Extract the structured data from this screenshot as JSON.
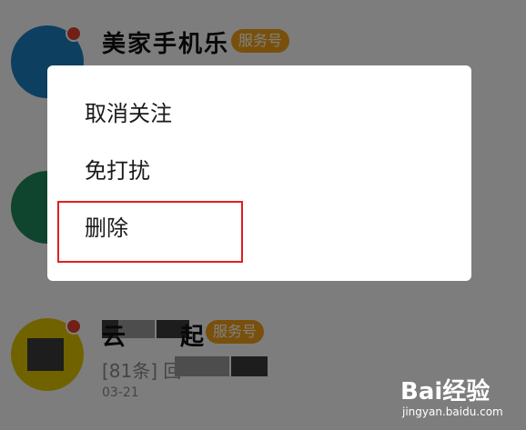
{
  "chat_list": [
    {
      "name": "美家手机乐",
      "badge": "服务号",
      "avatar_color": "#1b7fc1"
    },
    {
      "avatar_color": "#1f8a5c"
    },
    {
      "name": "云起",
      "badge": "服务号",
      "preview": "[81条] 回",
      "time": "03-21",
      "avatar_color": "#e3c400"
    }
  ],
  "context_menu": {
    "items": [
      {
        "label": "取消关注"
      },
      {
        "label": "免打扰"
      },
      {
        "label": "删除"
      }
    ],
    "highlighted_item": "删除",
    "highlight_color": "#e0201e"
  },
  "watermark": {
    "brand": "Bai经验",
    "site": "jingyan.baidu.com"
  },
  "colors": {
    "badge": "#f2a117",
    "unread_dot": "#e0402f",
    "overlay": "rgba(0,0,0,0.5)"
  }
}
